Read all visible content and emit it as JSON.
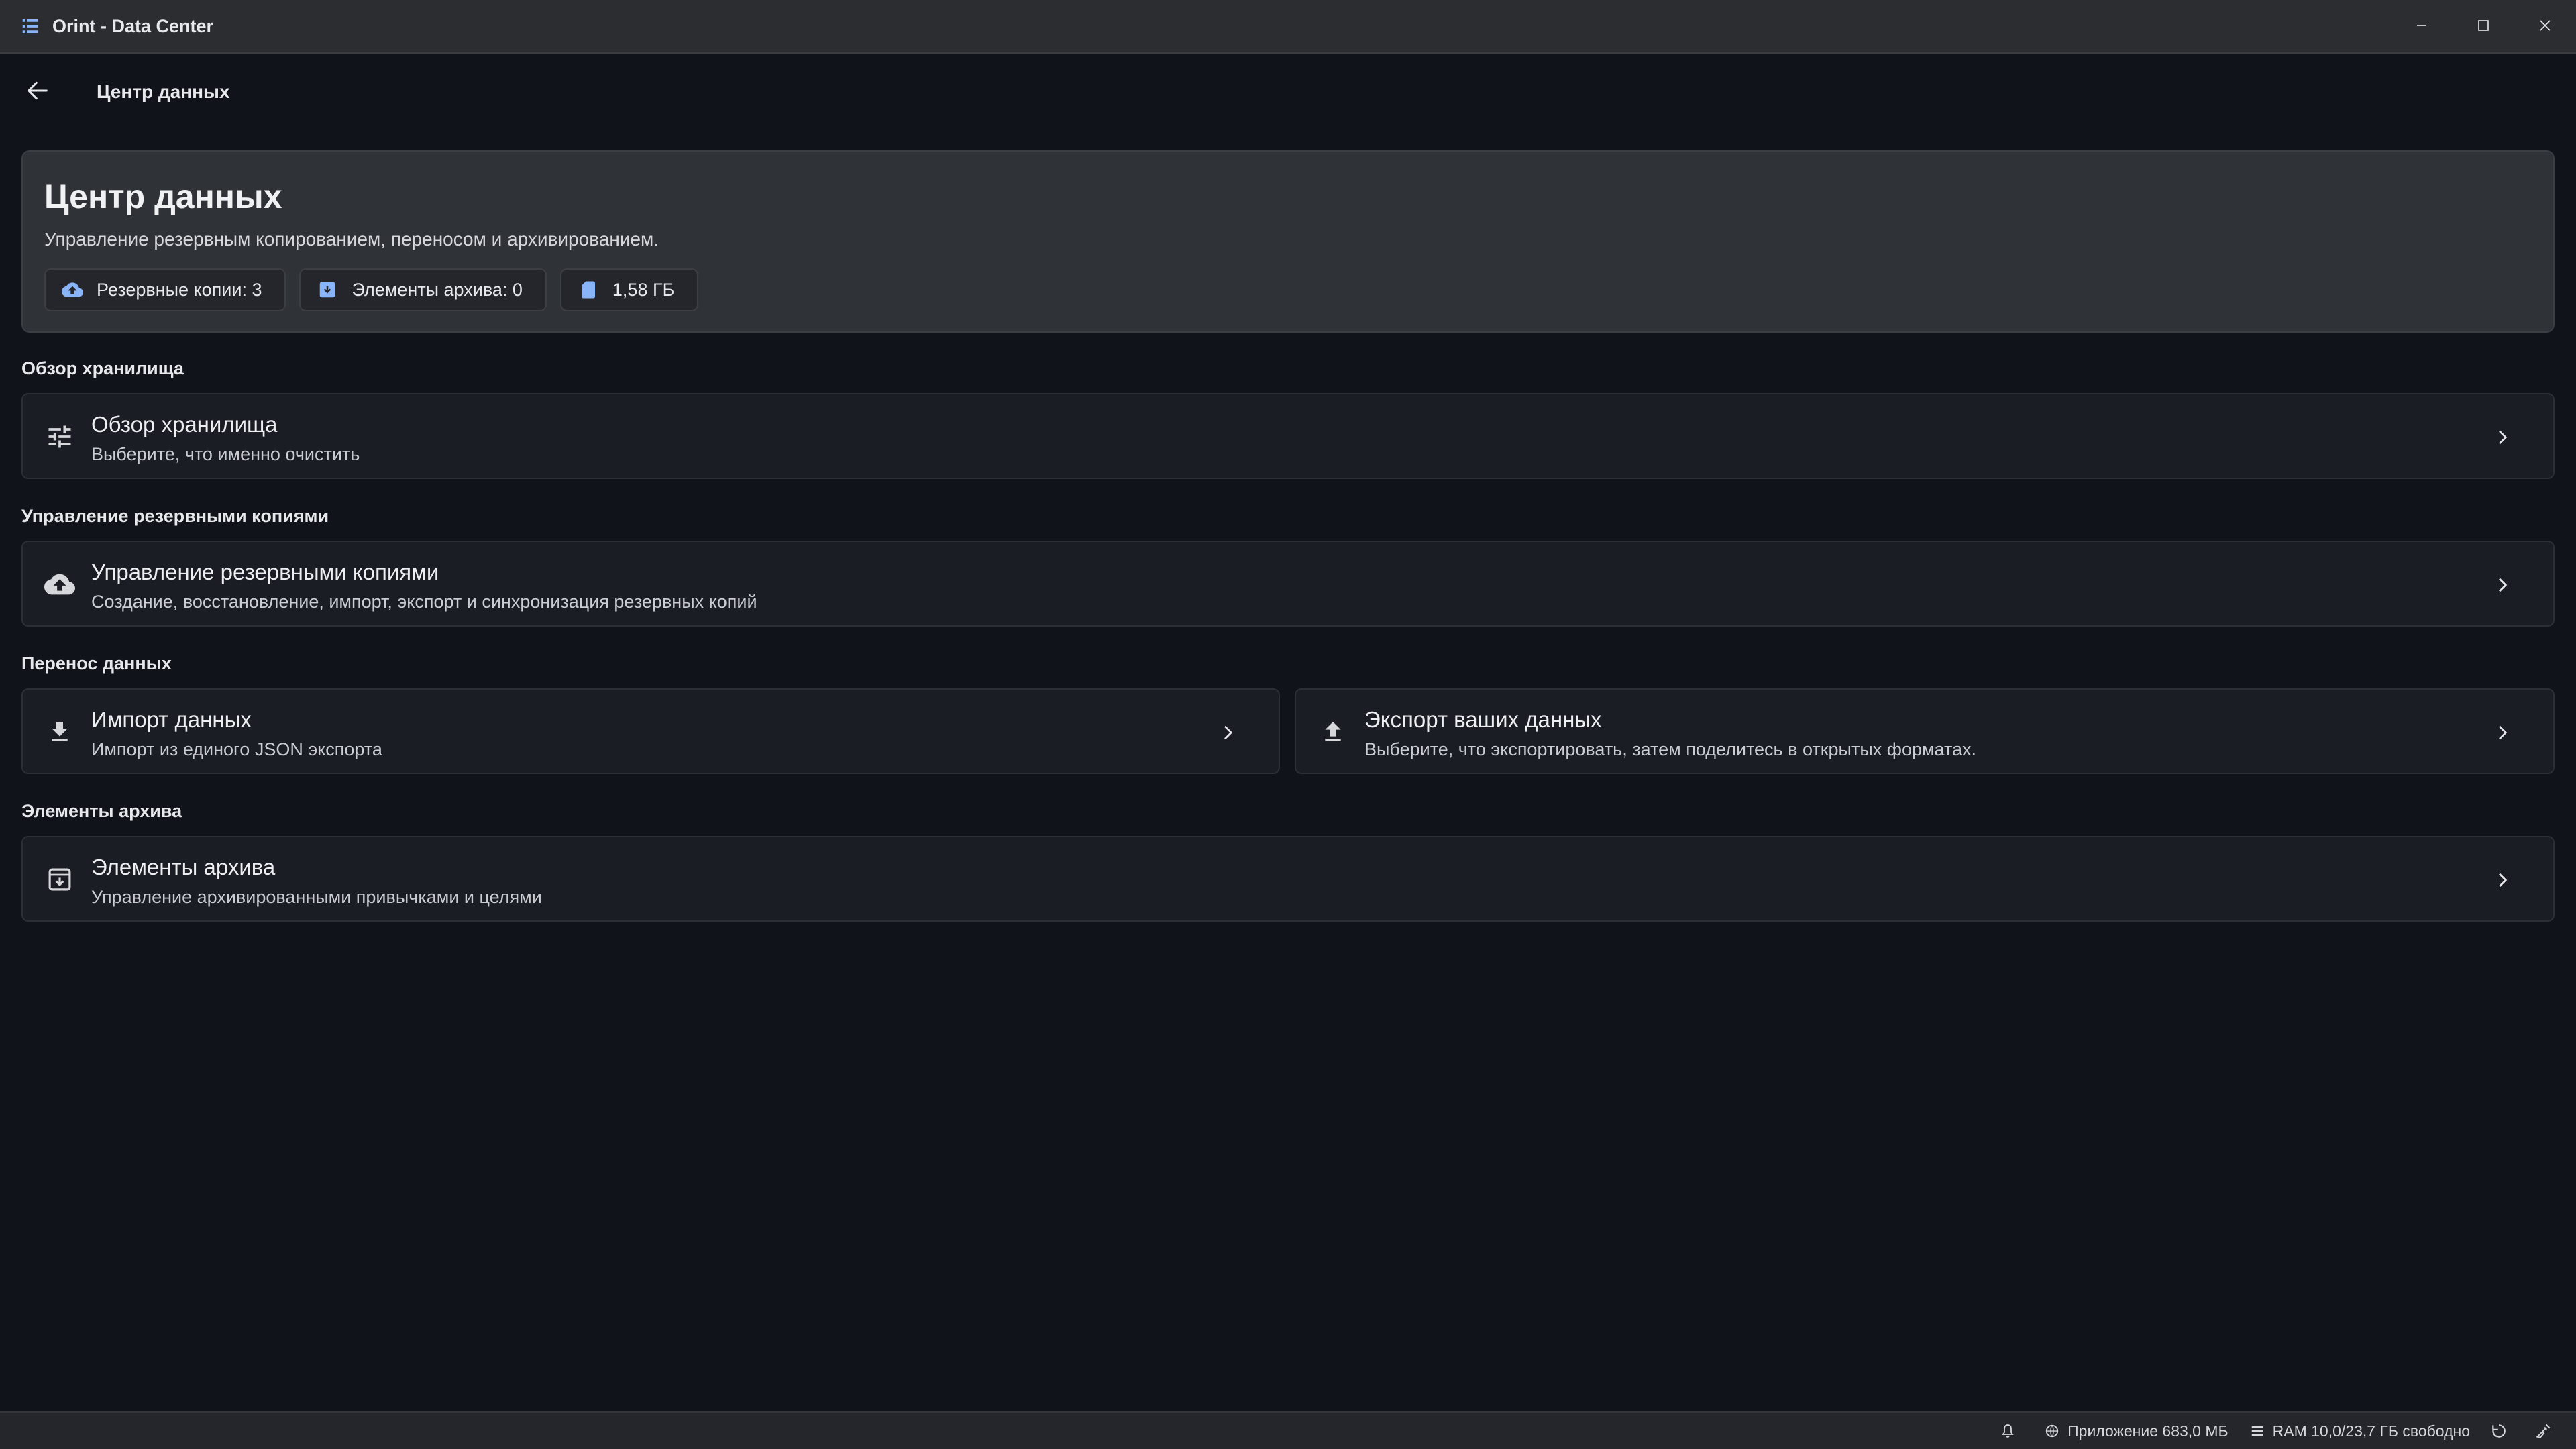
{
  "window": {
    "title": "Orint - Data Center",
    "controls": [
      "minimize-icon",
      "maximize-icon",
      "close-icon"
    ]
  },
  "appbar": {
    "back_icon": "arrow-left-icon",
    "title": "Центр данных"
  },
  "hero": {
    "title": "Центр данных",
    "subtitle": "Управление резервным копированием, переносом и архивированием.",
    "chips": [
      {
        "icon": "cloud-upload-icon",
        "label": "Резервные копии: 3"
      },
      {
        "icon": "archive-icon",
        "label": "Элементы архива: 0"
      },
      {
        "icon": "sd-card-icon",
        "label": "1,58 ГБ"
      }
    ]
  },
  "sections": {
    "storage": {
      "label": "Обзор хранилища",
      "card": {
        "icon": "tune-icon",
        "title": "Обзор хранилища",
        "subtitle": "Выберите, что именно очистить"
      }
    },
    "backups": {
      "label": "Управление резервными копиями",
      "card": {
        "icon": "cloud-upload-icon",
        "title": "Управление резервными копиями",
        "subtitle": "Создание, восстановление, импорт, экспорт и синхронизация резервных копий"
      }
    },
    "transfer": {
      "label": "Перенос данных",
      "import": {
        "icon": "download-icon",
        "title": "Импорт данных",
        "subtitle": "Импорт из единого JSON экспорта"
      },
      "export": {
        "icon": "upload-icon",
        "title": "Экспорт ваших данных",
        "subtitle": "Выберите, что экспортировать, затем поделитесь в открытых форматах."
      }
    },
    "archive": {
      "label": "Элементы архива",
      "card": {
        "icon": "archive-icon",
        "title": "Элементы архива",
        "subtitle": "Управление архивированными привычками и целями"
      }
    }
  },
  "statusbar": {
    "notification_icon": "bell-icon",
    "app_memory": "Приложение 683,0 МБ",
    "ram": "RAM 10,0/23,7 ГБ свободно",
    "icons": [
      "refresh-icon",
      "cleaning-icon"
    ]
  },
  "colors": {
    "background": "#10131a",
    "titlebar": "#2b2d31",
    "card": "#1a1d23",
    "hero": "#2f3237",
    "accent_blue": "#8ab4f8"
  }
}
